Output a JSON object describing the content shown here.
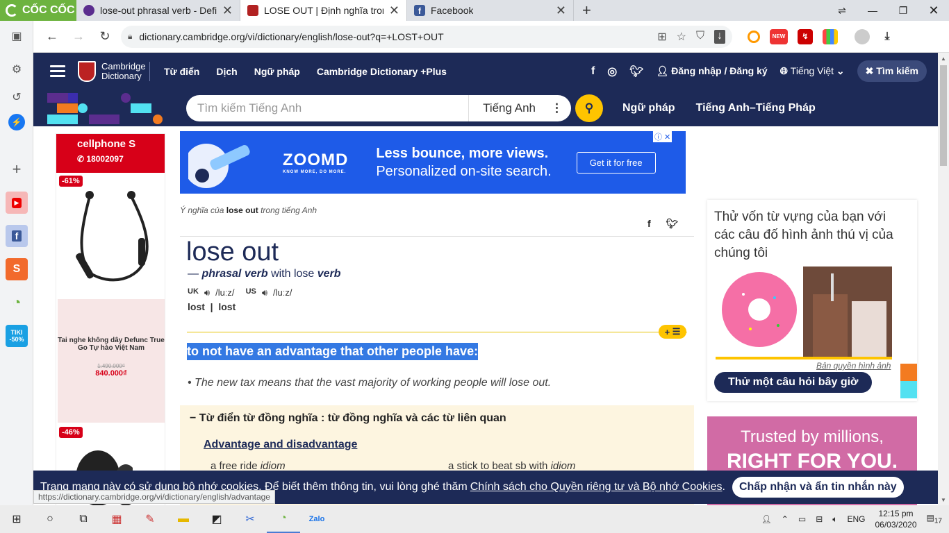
{
  "browser": {
    "brand": "CỐC CỐC",
    "tabs": [
      {
        "title": "lose-out phrasal verb - Defini",
        "active": false,
        "favicon_color": "#5b2d8e"
      },
      {
        "title": "LOSE OUT | Định nghĩa trong",
        "active": true,
        "favicon_color": "#b22222"
      },
      {
        "title": "Facebook",
        "active": false,
        "favicon_color": "#3b5998"
      }
    ],
    "url": "dictionary.cambridge.org/vi/dictionary/english/lose-out?q=+LOST+OUT",
    "ext_new_badge": "NEW",
    "status_url": "https://dictionary.cambridge.org/vi/dictionary/english/advantage"
  },
  "site": {
    "logo": "Cambridge Dictionary",
    "nav": [
      "Từ điển",
      "Dịch",
      "Ngữ pháp",
      "Cambridge Dictionary +Plus"
    ],
    "login": "Đăng nhập / Đăng ký",
    "language": "Tiếng Việt",
    "search_button": "Tìm kiếm",
    "search_placeholder": "Tìm kiếm Tiếng Anh",
    "search_lang": "Tiếng Anh",
    "sublinks": [
      "Ngữ pháp",
      "Tiếng Anh–Tiếng Pháp"
    ],
    "brand_color": "#1d2a57",
    "accent_color": "#fec400"
  },
  "left_ad": {
    "store": "cellphone S",
    "phone": "18002097",
    "badge1": "-61%",
    "product2": "Tai nghe không dây Defunc True Go Tự hào Việt Nam",
    "old_price": "1.490.000₫",
    "new_price": "840.000₫",
    "badge2": "-46%"
  },
  "banner_ad": {
    "logo": "ZOOMD",
    "logo_sub": "KNOW MORE, DO MORE.",
    "line1": "Less bounce, more views.",
    "line2": "Personalized on-site search.",
    "cta": "Get it for free"
  },
  "entry": {
    "crumb_pre": "Ý nghĩa của",
    "crumb_word": "lose out",
    "crumb_post": "trong tiếng Anh",
    "headword": "lose out",
    "pos_dash": "—",
    "pos": "phrasal verb",
    "pos_with": "with lose",
    "pos_verb": "verb",
    "uk": "UK",
    "uk_ipa": "/luːz/",
    "us": "US",
    "us_ipa": "/luːz/",
    "forms": "lost  |  lost",
    "plus_label": "+",
    "definition": "to not have an advantage that other people have:",
    "example": "The new tax means that the vast majority of working people will lose out.",
    "thesaurus_header": "Từ điển từ đồng nghĩa : từ đồng nghĩa và các từ liên quan",
    "thesaurus_link": "Advantage and disadvantage",
    "thesaurus_item1": "a free ride",
    "thesaurus_item1_tag": "idiom",
    "thesaurus_item2": "a stick to beat sb with",
    "thesaurus_item2_tag": "idiom"
  },
  "right_col": {
    "quiz_text": "Thử vốn từ vựng của bạn với các câu đố hình ảnh thú vị của chúng tôi",
    "copyright": "Bản quyền hình ảnh",
    "quiz_button": "Thử một câu hỏi bây giờ",
    "trusted1": "Trusted by millions,",
    "trusted2": "RIGHT FOR YOU."
  },
  "cookie": {
    "text": "Trang mạng này có sử dụng bộ nhớ cookies. Để biết thêm thông tin, vui lòng ghé thăm",
    "link": "Chính sách cho Quyền riêng tư và Bộ nhớ Cookies",
    "accept": "Chấp nhận và ẩn tin nhắn này"
  },
  "taskbar": {
    "lang": "ENG",
    "time": "12:15 pm",
    "date": "06/03/2020",
    "notifications": "17"
  }
}
